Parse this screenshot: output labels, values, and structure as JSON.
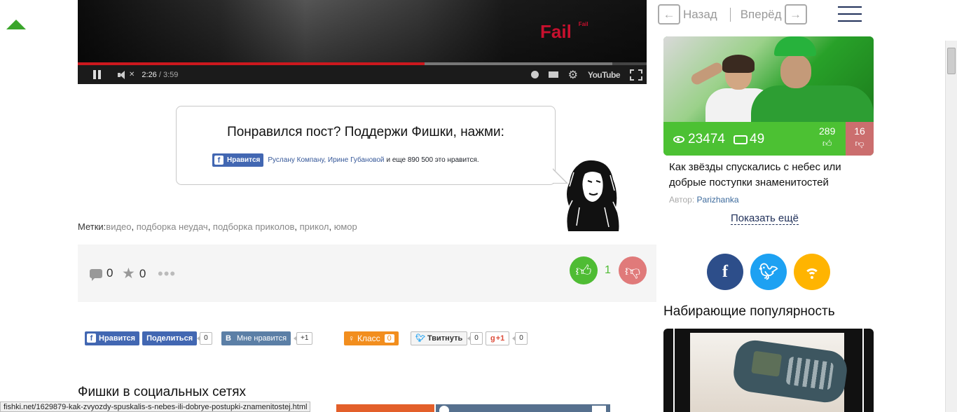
{
  "video": {
    "logo": "Fail",
    "logo_small": "Fail",
    "time_current": "2:26",
    "time_separator": " / ",
    "time_total": "3:59",
    "progress_fraction": 0.61,
    "buffered_fraction": 0.94,
    "youtube_label": "YouTube"
  },
  "likebox": {
    "title": "Понравился пост? Поддержи Фишки, нажми:",
    "button_label": "Нравится",
    "names": "Руслану Компану, Ирине Губановой",
    "rest": "и еще 890 500 это нравится."
  },
  "tags": {
    "label": "Метки:",
    "items": [
      "видео",
      "подборка неудач",
      "подборка приколов",
      "прикол",
      "юмор"
    ],
    "separator": ", "
  },
  "stats": {
    "comments": "0",
    "favorites": "0",
    "more": "•••",
    "likes": "1"
  },
  "share": {
    "fb_like": "Нравится",
    "fb_share": "Поделиться",
    "fb_count": "0",
    "vk_label": "Мне нравится",
    "vk_count": "+1",
    "ok_label": "Класс",
    "ok_count": "0",
    "tw_label": "Твитнуть",
    "tw_count": "0",
    "gp_label": "+1",
    "gp_count": "0"
  },
  "social_title": "Фишки в социальных сетях",
  "status_url": "fishki.net/1629879-kak-zvyozdy-spuskalis-s-nebes-ili-dobrye-postupki-znamenitostej.html",
  "nav": {
    "back": "Назад",
    "forward": "Вперёд"
  },
  "card": {
    "views": "23474",
    "comments": "49",
    "likes": "289",
    "dislikes": "16",
    "title": "Как звёзды спускались с небес или добрые поступки знаменитостей",
    "author_label": "Автор:",
    "author": "Parizhanka"
  },
  "show_more": "Показать ещё",
  "follow": {
    "fb": "f"
  },
  "popular_title": "Набирающие популярность",
  "colors": {
    "green": "#4cc133",
    "red_vote": "#e07a7a",
    "fb_blue": "#4267b2",
    "navy": "#21315a"
  }
}
